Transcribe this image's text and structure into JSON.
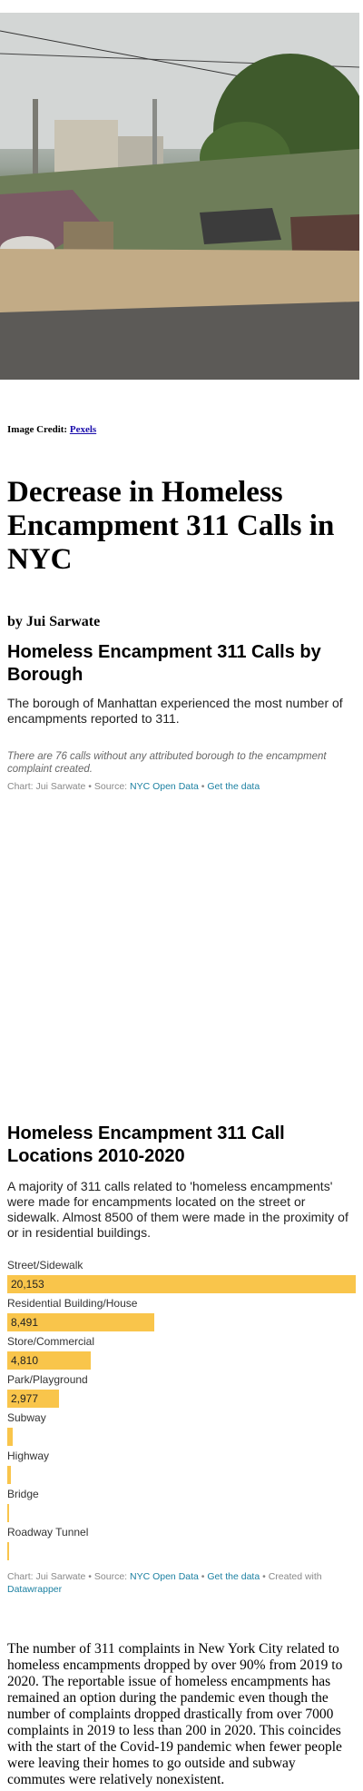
{
  "image_credit": {
    "label": "Image Credit:",
    "link": "Pexels"
  },
  "article": {
    "title": "Decrease in Homeless Encampment 311 Calls in NYC",
    "byline": "by Jui Sarwate",
    "paragraph": "The number of 311 complaints in New York City related to homeless encampments dropped by over 90% from 2019 to 2020. The reportable issue of homeless encampments has remained an option during the pandemic even though the number of complaints dropped drastically from over 7000 complaints in 2019 to less than 200 in 2020. This coincides with the start of the Covid-19 pandemic when fewer people were leaving their homes to go outside and subway commutes were relatively nonexistent."
  },
  "chart_borough": {
    "title": "Homeless Encampment 311 Calls by Borough",
    "description": "The borough of Manhattan experienced the most number of encampments reported to 311.",
    "note": "There are 76 calls without any attributed borough to the encampment complaint created.",
    "footer": {
      "chart_by": "Chart: Jui Sarwate",
      "sep1": " • Source: ",
      "source": "NYC Open Data",
      "sep2": " • ",
      "get_data": "Get the data"
    }
  },
  "chart_locations": {
    "title": "Homeless Encampment 311 Call Locations 2010-2020",
    "description": "A majority of 311 calls related to 'homeless encampments' were made for encampments located on the street or sidewalk. Almost 8500 of them were made in the proximity of or in residential buildings.",
    "footer": {
      "chart_by": "Chart: Jui Sarwate",
      "sep1": " • Source: ",
      "source": "NYC Open Data",
      "sep2": " • ",
      "get_data": "Get the data",
      "sep3": " • Created with ",
      "created_with": "Datawrapper"
    }
  },
  "chart_data": {
    "type": "bar",
    "title": "Homeless Encampment 311 Call Locations 2010-2020",
    "categories": [
      "Street/Sidewalk",
      "Residential Building/House",
      "Store/Commercial",
      "Park/Playground",
      "Subway",
      "Highway",
      "Bridge",
      "Roadway Tunnel"
    ],
    "values": [
      20153,
      8491,
      4810,
      2977,
      320,
      230,
      60,
      40
    ],
    "value_labels": [
      "20,153",
      "8,491",
      "4,810",
      "2,977",
      "",
      "",
      "",
      ""
    ],
    "xlim": [
      0,
      20153
    ],
    "bar_color": "#f9c54b"
  }
}
